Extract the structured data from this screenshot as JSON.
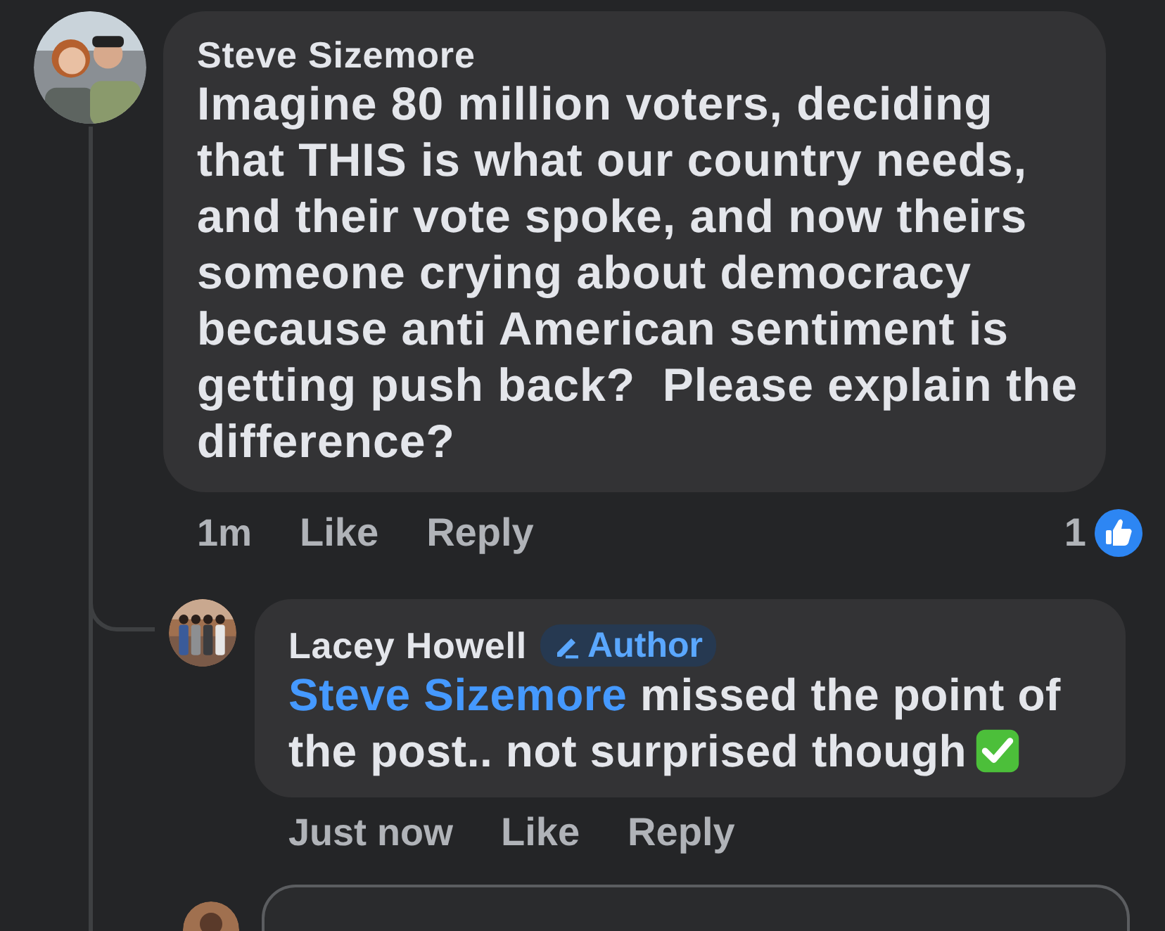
{
  "comments": [
    {
      "author": "Steve Sizemore",
      "text": "Imagine 80 million voters, deciding that THIS is what our country needs, and their vote spoke, and now theirs someone crying about democracy because anti American sentiment is getting push back?  Please explain the difference?",
      "time": "1m",
      "actions": [
        "Like",
        "Reply"
      ],
      "reaction_count": "1",
      "replies": [
        {
          "author": "Lacey Howell",
          "badge": "Author",
          "mention": "Steve Sizemore",
          "text": "missed the point of the post.. not surprised though",
          "check_emoji": true,
          "time": "Just now",
          "actions": [
            "Like",
            "Reply"
          ]
        }
      ]
    }
  ]
}
